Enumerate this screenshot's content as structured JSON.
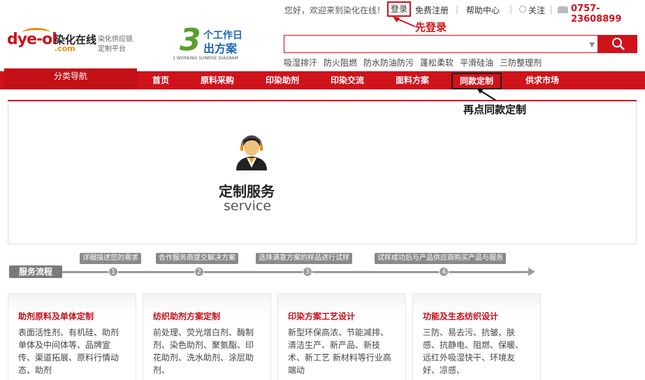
{
  "topbar": {
    "welcome": "您好，欢迎来到染化在线！",
    "login": "登录",
    "register": "免费注册",
    "help": "帮助中心",
    "follow": "关注",
    "phone": "0757-23608899"
  },
  "annotations": {
    "step1": "先登录",
    "step2": "再点同款定制"
  },
  "logo": {
    "main": "dye-ol",
    "cn": "染化在线",
    "com": ".com",
    "sub1": "染化供应链",
    "sub2": "定制平台"
  },
  "badge": {
    "num": "3",
    "line1": "个工作日",
    "line2": "出方案",
    "en": "3 WORKING SUNRISE DIAGRAM"
  },
  "search": {
    "placeholder": "",
    "tags": [
      "吸湿排汗",
      "防火阻燃",
      "防水防油防污",
      "蓬松柔软",
      "平滑硅油",
      "三防整理剂"
    ]
  },
  "nav": {
    "category": "分类导航",
    "items": [
      "首页",
      "原料采购",
      "印染助剂",
      "印染交流",
      "面料方案",
      "同款定制",
      "供求市场"
    ]
  },
  "service": {
    "title": "定制服务",
    "en": "service"
  },
  "flow": {
    "label": "服务流程",
    "steps": [
      {
        "num": "1",
        "text": "详细描述您的需求"
      },
      {
        "num": "2",
        "text": "合作服务商提交解决方案"
      },
      {
        "num": "3",
        "text": "选择满意方案的样品进行试样"
      },
      {
        "num": "4",
        "text": "试样成功后与产品供应商购买产品与服务"
      }
    ]
  },
  "cards": [
    {
      "title": "助剂原料及单体定制",
      "desc": "表面活性剂、有机硅、助剂单体及中间体等、品牌宣传、渠道拓展、原料行情动态、助剂"
    },
    {
      "title": "纺织助剂方案定制",
      "desc": "前处理、荧光增白剂、酶制剂、染色助剂、聚氨酯、印花助剂、洗水助剂、涂层助剂、"
    },
    {
      "title": "印染方案工艺设计",
      "desc": "新型环保高浓、节能减排、清洁生产、新产品、新技术、新工艺 新材料等行业高端动"
    },
    {
      "title": "功能及生态纺织设计",
      "desc": "三防、易去污、抗皱、肤感、抗静电、阻燃、保暖、远红外吸湿快干、环境友好、凉感、"
    }
  ]
}
